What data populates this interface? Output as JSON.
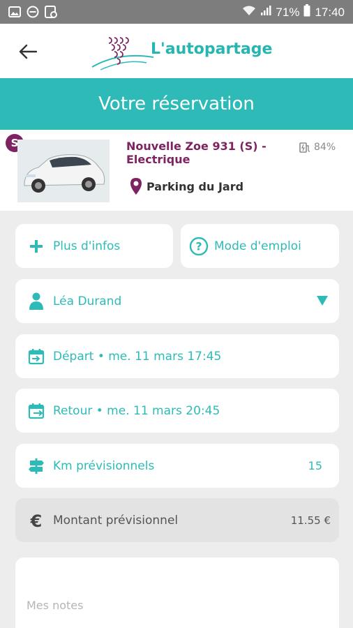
{
  "status_bar": {
    "battery": "71%",
    "time": "17:40"
  },
  "header": {
    "brand": "L'autopartage",
    "title": "Votre réservation"
  },
  "vehicle": {
    "badge": "S",
    "name": "Nouvelle Zoe 931 (S) - Electrique",
    "battery": "84%",
    "parking": "Parking du Jard"
  },
  "actions": {
    "info": "Plus d'infos",
    "help": "Mode d'emploi"
  },
  "user": {
    "name": "Léa Durand"
  },
  "departure": "Départ • me. 11 mars 17:45",
  "return": "Retour • me. 11 mars 20:45",
  "km": {
    "label": "Km prévisionnels",
    "value": "15"
  },
  "amount": {
    "label": "Montant prévisionnel",
    "value": "11.55 €"
  },
  "notes": {
    "placeholder": "Mes notes"
  },
  "colors": {
    "teal": "#2ebbb7",
    "plum": "#7d2361",
    "statusbar": "#7d7d7d"
  }
}
